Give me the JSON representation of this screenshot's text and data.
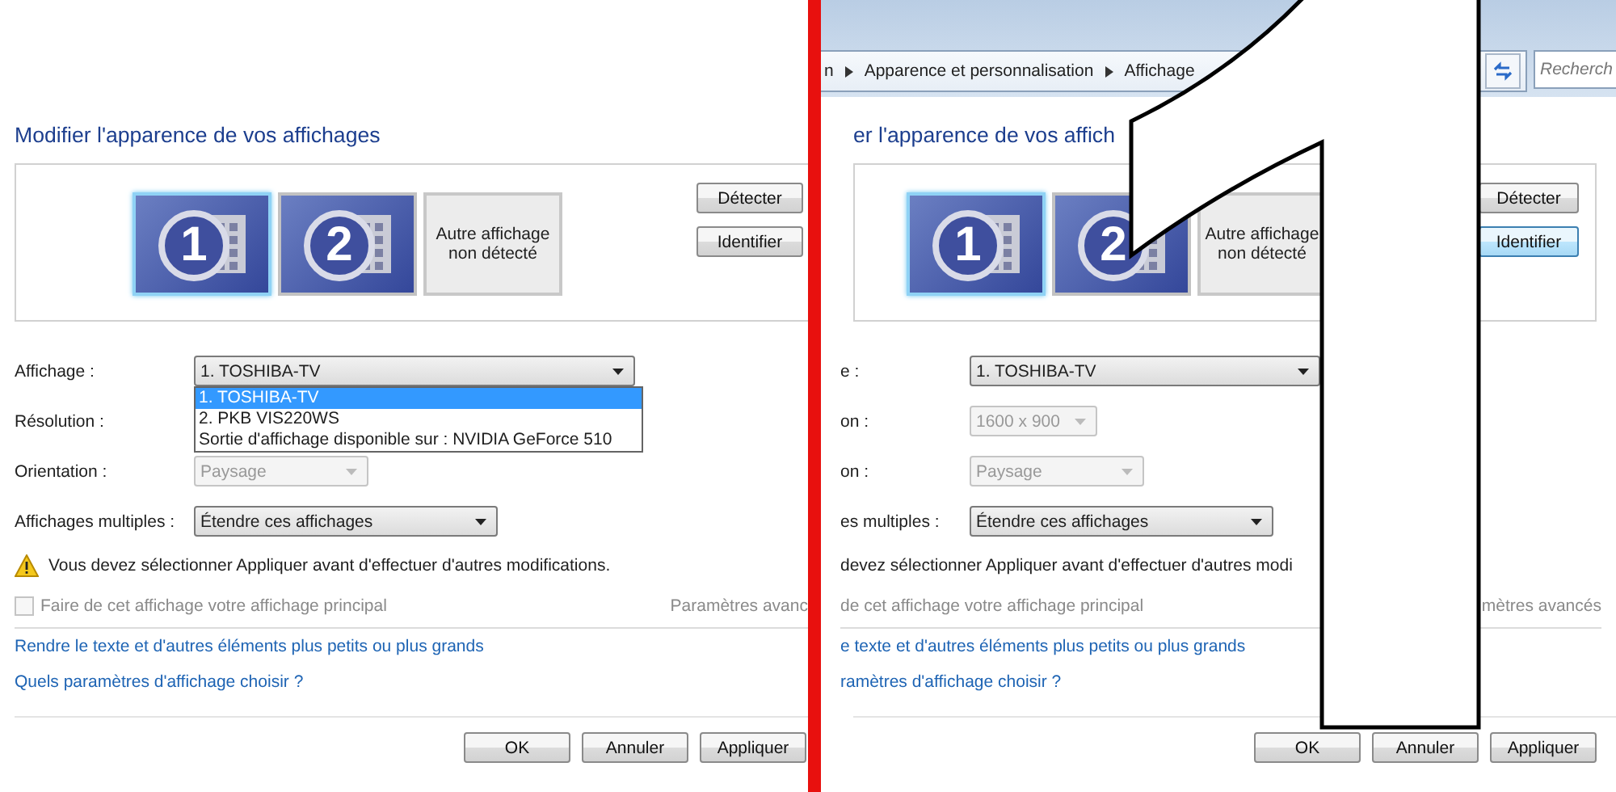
{
  "panels": [
    {
      "title": "Modifier l'apparence de vos affichages",
      "monitors": [
        {
          "kind": "screen",
          "number": "1",
          "selected": true
        },
        {
          "kind": "screen",
          "number": "2",
          "selected": false
        },
        {
          "kind": "missing",
          "label": "Autre affichage non détecté",
          "selected": false
        }
      ],
      "side_buttons": [
        {
          "label": "Détecter",
          "hover": false
        },
        {
          "label": "Identifier",
          "hover": false
        }
      ],
      "rows": [
        {
          "kind": "display",
          "label": "Affichage :",
          "value": "1. TOSHIBA-TV",
          "disabled": false,
          "options": [
            {
              "label": "1. TOSHIBA-TV",
              "selected": true
            },
            {
              "label": "2. PKB VIS220WS",
              "selected": false
            },
            {
              "label": "Sortie d'affichage disponible sur : NVIDIA GeForce 510",
              "selected": false
            }
          ]
        },
        {
          "kind": "resolution",
          "label": "Résolution :"
        },
        {
          "kind": "orientation",
          "label": "Orientation :",
          "value": "Paysage",
          "disabled": true
        },
        {
          "kind": "multiple",
          "label": "Affichages multiples :",
          "value": "Étendre ces affichages",
          "disabled": false
        }
      ],
      "warning": {
        "text": "Vous devez sélectionner Appliquer avant d'effectuer d'autres modifications.",
        "icon": true
      },
      "primary": {
        "label": "Faire de cet affichage votre affichage principal",
        "checked": false,
        "disabled": true
      },
      "advanced_link": "Paramètres avanc",
      "links": [
        "Rendre le texte et d'autres éléments plus petits ou plus grands",
        "Quels paramètres d'affichage choisir ?"
      ],
      "footer_buttons": [
        "OK",
        "Annuler",
        "Appliquer"
      ]
    },
    {
      "breadcrumb": [
        "n",
        "Apparence et personnalisation",
        "Affichage"
      ],
      "search": {
        "placeholder": "Recherch"
      },
      "title": "er l'apparence de vos affich",
      "monitors": [
        {
          "kind": "screen",
          "number": "1",
          "selected": true
        },
        {
          "kind": "screen",
          "number": "2",
          "selected": false
        },
        {
          "kind": "missing",
          "label": "Autre affichage non détecté",
          "selected": false
        }
      ],
      "side_buttons": [
        {
          "label": "Détecter",
          "hover": false
        },
        {
          "label": "Identifier",
          "hover": true
        }
      ],
      "rows": [
        {
          "kind": "display",
          "label": "e :",
          "value": "1. TOSHIBA-TV",
          "disabled": false
        },
        {
          "kind": "resolution",
          "label": "on :",
          "value": "1600 x 900",
          "disabled": true
        },
        {
          "kind": "orientation",
          "label": "on :",
          "value": "Paysage",
          "disabled": true
        },
        {
          "kind": "multiple",
          "label": "es multiples :",
          "value": "Étendre ces affichages",
          "disabled": false
        }
      ],
      "warning": {
        "text": "devez sélectionner Appliquer avant d'effectuer d'autres modi",
        "icon": false
      },
      "primary": {
        "label": "de cet affichage votre affichage principal",
        "disabled": true
      },
      "advanced_link": "mètres avancés",
      "links": [
        "e texte et d'autres éléments plus petits ou plus grands",
        "ramètres d'affichage choisir ?"
      ],
      "footer_buttons": [
        "OK",
        "Annuler",
        "Appliquer"
      ]
    }
  ]
}
